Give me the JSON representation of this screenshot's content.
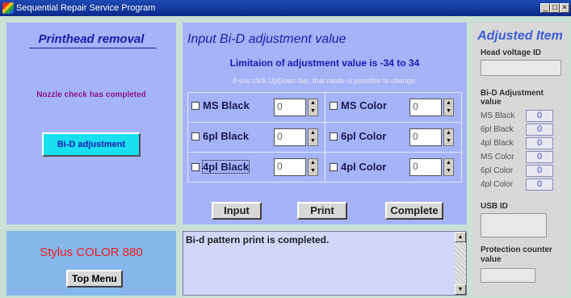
{
  "window": {
    "title": "Sequential Repair Service Program",
    "minimize": "_",
    "restore": "□",
    "close": "×"
  },
  "left": {
    "title": "Printhead removal",
    "status": "Nozzle check has completed",
    "bid_button": "Bi-D adjustment"
  },
  "middle": {
    "title": "Input Bi-D adjustment value",
    "limit": "Limitaion of adjustment value is -34 to 34",
    "hint": "If you click UpDown bar, that mode is possible to change.",
    "cells": [
      {
        "label": "MS Black",
        "value": "0"
      },
      {
        "label": "MS Color",
        "value": "0"
      },
      {
        "label": "6pl Black",
        "value": "0"
      },
      {
        "label": "6pl Color",
        "value": "0"
      },
      {
        "label": "4pl Black",
        "value": "0"
      },
      {
        "label": "4pl Color",
        "value": "0"
      }
    ],
    "buttons": {
      "input": "Input",
      "print": "Print",
      "complete": "Complete"
    }
  },
  "right": {
    "title": "Adjusted Item",
    "head_voltage_label": "Head voltage ID",
    "bid_label": "Bi-D Adjustment value",
    "rows": [
      {
        "name": "MS Black",
        "value": "0"
      },
      {
        "name": "6pl Black",
        "value": "0"
      },
      {
        "name": "4pl Black",
        "value": "0"
      },
      {
        "name": "MS Color",
        "value": "0"
      },
      {
        "name": "6pl Color",
        "value": "0"
      },
      {
        "name": "4pl Color",
        "value": "0"
      }
    ],
    "usb_label": "USB ID",
    "protection_label": "Protection counter value"
  },
  "model": {
    "name": "Stylus COLOR 880",
    "top_menu": "Top Menu"
  },
  "message": {
    "text": "Bi-d pattern print is completed."
  },
  "icons": {
    "spin_up": "▲",
    "spin_down": "▼"
  }
}
